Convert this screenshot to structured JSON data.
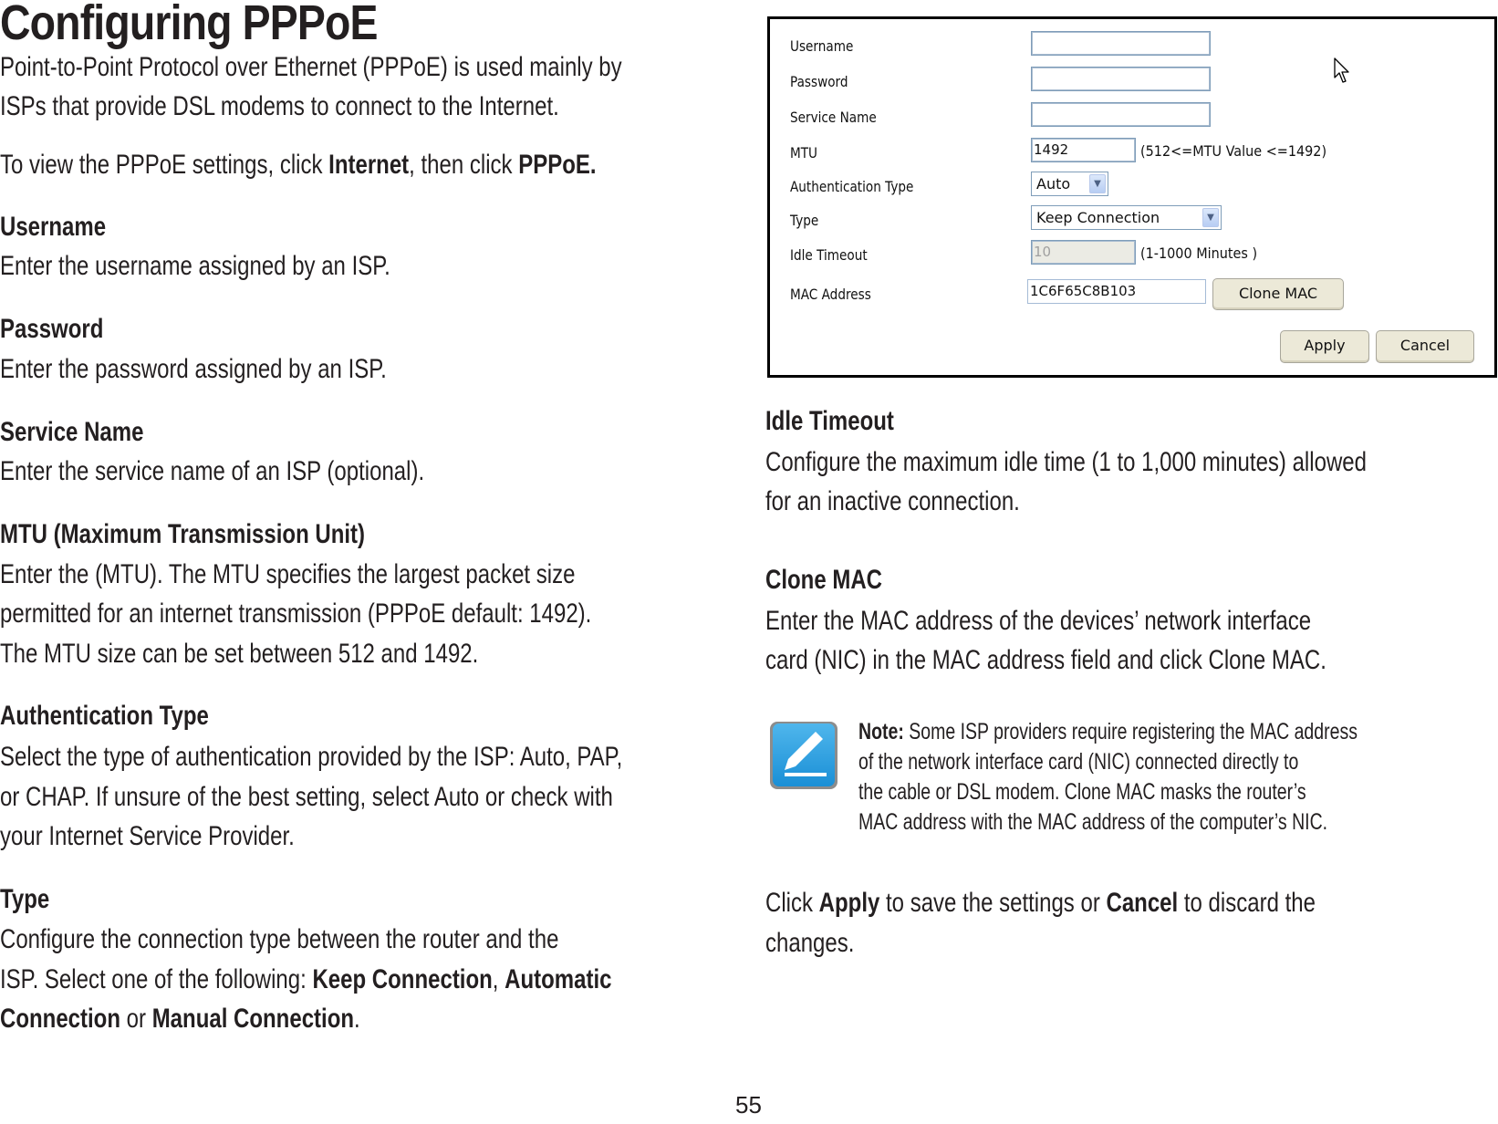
{
  "page": {
    "title": "Configuring PPPoE",
    "intro": "Point-to-Point Protocol over Ethernet (PPPoE) is used mainly by",
    "intro2": "ISPs that provide DSL modems to connect to the Internet.",
    "instruction": {
      "prefix": "To view the PPPoE settings, click ",
      "bold1": "Internet",
      "mid": ", then click ",
      "bold2": "PPPoE."
    },
    "page_number": "55"
  },
  "sections_left": [
    {
      "heading": "Username",
      "lines": [
        "Enter the username assigned by an ISP."
      ]
    },
    {
      "heading": "Password",
      "lines": [
        "Enter the password assigned by an ISP."
      ]
    },
    {
      "heading": "Service Name",
      "lines": [
        "Enter the service name of an ISP (optional)."
      ]
    },
    {
      "heading": "MTU (Maximum Transmission Unit)",
      "lines": [
        "Enter the (MTU). The MTU specifies the largest packet size",
        "permitted for an internet transmission (PPPoE default: 1492).",
        "The MTU size can be set between 512 and 1492."
      ]
    },
    {
      "heading": "Authentication Type",
      "lines": [
        "Select the type of authentication provided by the ISP: Auto, PAP,",
        "or CHAP. If unsure of the best setting, select Auto or check with",
        "your Internet Service Provider."
      ]
    },
    {
      "heading": "Type",
      "lines": [
        "Configure the connection type between the router and the"
      ],
      "line2": {
        "prefix": "ISP. Select one of the following: ",
        "b1": "Keep Connection",
        "sep": ", ",
        "b2": "Automatic"
      },
      "line3": {
        "b1": "Connection",
        "mid": " or ",
        "b2": "Manual Connection",
        "end": "."
      }
    }
  ],
  "sections_right": [
    {
      "heading": "Idle Timeout",
      "lines": [
        "Configure the maximum idle time (1 to 1,000 minutes) allowed",
        "for an inactive connection."
      ]
    },
    {
      "heading": "Clone MAC",
      "lines": [
        "Enter the MAC address of the devices’ network interface",
        "card (NIC) in the MAC address field and click Clone MAC."
      ]
    }
  ],
  "note": {
    "icon": "pencil-note-icon",
    "label": "Note:",
    "line1": " Some ISP providers require registering the MAC address",
    "line2": "of the network interface card (NIC) connected directly to",
    "line3": "the cable or DSL modem. Clone MAC masks the router’s",
    "line4": "MAC address with the MAC address of the computer’s NIC."
  },
  "closing": {
    "prefix": "Click ",
    "b1": "Apply",
    "mid": " to save the settings or ",
    "b2": "Cancel",
    "end": " to discard the",
    "line2": "changes."
  },
  "form": {
    "username_label": "Username",
    "username_value": "",
    "password_label": "Password",
    "password_value": "",
    "service_label": "Service Name",
    "service_value": "",
    "mtu_label": "MTU",
    "mtu_value": "1492",
    "mtu_hint": "(512<=MTU Value <=1492)",
    "auth_label": "Authentication Type",
    "auth_value": "Auto",
    "type_label": "Type",
    "type_value": "Keep Connection",
    "idle_label": "Idle Timeout",
    "idle_value": "10",
    "idle_hint": "(1-1000 Minutes )",
    "mac_label": "MAC Address",
    "mac_value": "1C6F65C8B103",
    "clone_button": "Clone MAC",
    "apply_button": "Apply",
    "cancel_button": "Cancel"
  }
}
